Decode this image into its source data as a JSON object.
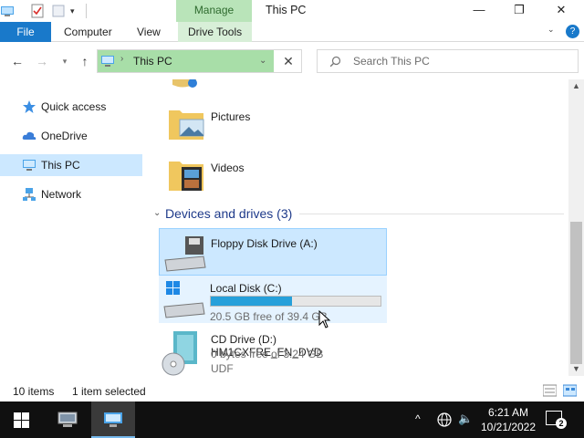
{
  "window": {
    "title": "This PC",
    "context_tab": "Manage",
    "minimize_glyph": "—",
    "maximize_glyph": "❐",
    "close_glyph": "✕"
  },
  "ribbon": {
    "tabs": [
      {
        "label": "File"
      },
      {
        "label": "Computer"
      },
      {
        "label": "View"
      },
      {
        "label": "Drive Tools"
      }
    ],
    "help_glyph": "?"
  },
  "address": {
    "path": "This PC",
    "search_placeholder": "Search This PC"
  },
  "nav_pane": {
    "items": [
      {
        "label": "Quick access",
        "icon": "star-icon"
      },
      {
        "label": "OneDrive",
        "icon": "cloud-icon"
      },
      {
        "label": "This PC",
        "icon": "computer-icon",
        "selected": true
      },
      {
        "label": "Network",
        "icon": "network-icon"
      }
    ]
  },
  "content": {
    "folders": [
      {
        "label": "Pictures",
        "icon": "pictures-folder-icon"
      },
      {
        "label": "Videos",
        "icon": "videos-folder-icon"
      }
    ],
    "group_header": "Devices and drives (3)",
    "drives": [
      {
        "label": "Floppy Disk Drive (A:)",
        "icon": "floppy-drive-icon"
      },
      {
        "label": "Local Disk (C:)",
        "icon": "local-disk-icon",
        "free_text": "20.5 GB free of 39.4 GB",
        "used_fraction": 0.48
      },
      {
        "label": "CD Drive (D:) HM1CXFRE_EN_DVD",
        "icon": "cd-drive-icon",
        "free_text": "0 bytes free of 3.24 GB",
        "fs": "UDF"
      }
    ]
  },
  "status": {
    "count": "10 items",
    "selection": "1 item selected"
  },
  "taskbar": {
    "time": "6:21 AM",
    "date": "10/21/2022",
    "notification_count": "2"
  },
  "colors": {
    "accent": "#1979ca",
    "manage_tab": "#b9e4b9",
    "selection": "#cce8ff",
    "progress": "#26a0da",
    "taskbar": "#101010"
  }
}
